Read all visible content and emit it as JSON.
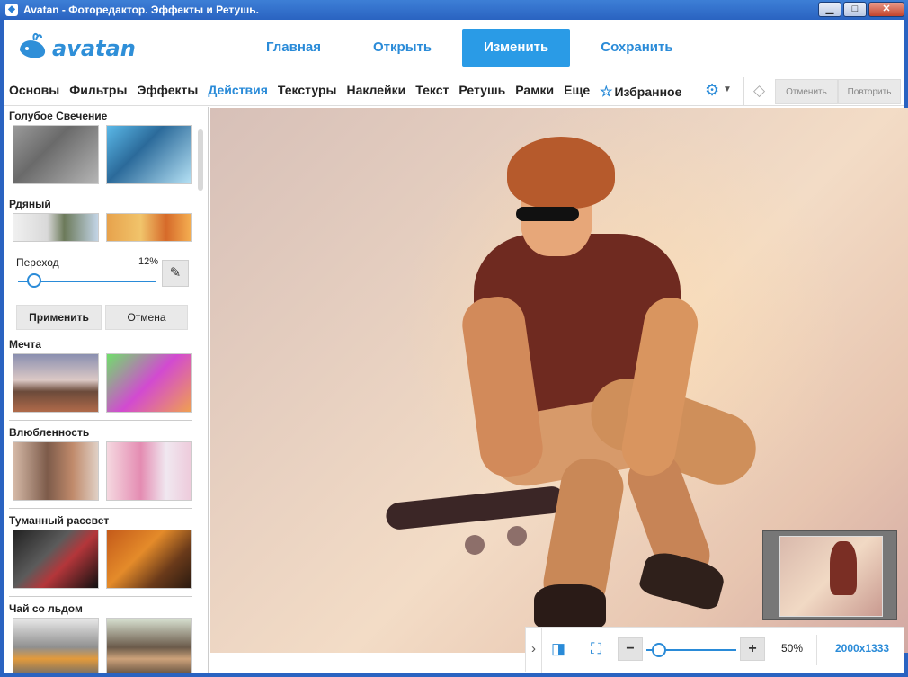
{
  "window": {
    "title": "Avatan - Фотоpедактор. Эффекты и Ретушь.",
    "app_icon": "avatan-whale-icon",
    "minimize_glyph": "▁",
    "maximize_glyph": "□",
    "close_glyph": "✕"
  },
  "logo": {
    "text": "avatan"
  },
  "topnav": [
    {
      "label": "Главная",
      "active": false
    },
    {
      "label": "Открыть",
      "active": false
    },
    {
      "label": "Изменить",
      "active": true
    },
    {
      "label": "Сохранить",
      "active": false
    }
  ],
  "tabs": {
    "items": [
      "Основы",
      "Фильтры",
      "Эффекты",
      "Действия",
      "Текстуры",
      "Наклейки",
      "Текст",
      "Ретушь",
      "Рамки",
      "Еще"
    ],
    "active": "Действия",
    "favorites": "Избранное"
  },
  "toolbar": {
    "undo": "Отменить",
    "redo": "Повторить"
  },
  "effects": [
    {
      "name": "Голубое Свечение"
    },
    {
      "name": "Рдяный"
    },
    {
      "name": "Мечта"
    },
    {
      "name": "Влюбленность"
    },
    {
      "name": "Туманный рассвет"
    },
    {
      "name": "Чай со льдом"
    }
  ],
  "transition": {
    "label": "Переход",
    "value_text": "12%",
    "value": 12
  },
  "actions": {
    "apply": "Применить",
    "cancel": "Отмена"
  },
  "bottom": {
    "zoom": "50%",
    "zoom_value": 50,
    "dimensions": "2000x1333"
  },
  "colors": {
    "accent": "#2a8bd8",
    "active_nav": "#2a9be6",
    "titlebar": "#2a63c1"
  }
}
